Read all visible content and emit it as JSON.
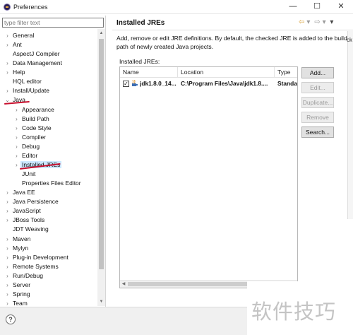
{
  "window": {
    "title": "Preferences",
    "controls": {
      "minimize": "—",
      "maximize": "☐",
      "close": "✕"
    }
  },
  "filter": {
    "placeholder": "type filter text",
    "value": ""
  },
  "tree": [
    {
      "label": "General",
      "expander": "›",
      "indent": 0
    },
    {
      "label": "Ant",
      "expander": "›",
      "indent": 0
    },
    {
      "label": "AspectJ Compiler",
      "expander": "",
      "indent": 0
    },
    {
      "label": "Data Management",
      "expander": "›",
      "indent": 0
    },
    {
      "label": "Help",
      "expander": "›",
      "indent": 0
    },
    {
      "label": "HQL editor",
      "expander": "",
      "indent": 0
    },
    {
      "label": "Install/Update",
      "expander": "›",
      "indent": 0
    },
    {
      "label": "Java",
      "expander": "⌄",
      "indent": 0
    },
    {
      "label": "Appearance",
      "expander": "›",
      "indent": 1
    },
    {
      "label": "Build Path",
      "expander": "›",
      "indent": 1
    },
    {
      "label": "Code Style",
      "expander": "›",
      "indent": 1
    },
    {
      "label": "Compiler",
      "expander": "›",
      "indent": 1
    },
    {
      "label": "Debug",
      "expander": "›",
      "indent": 1
    },
    {
      "label": "Editor",
      "expander": "›",
      "indent": 1
    },
    {
      "label": "Installed JREs",
      "expander": "›",
      "indent": 1,
      "selected": true
    },
    {
      "label": "JUnit",
      "expander": "",
      "indent": 1
    },
    {
      "label": "Properties Files Editor",
      "expander": "",
      "indent": 1
    },
    {
      "label": "Java EE",
      "expander": "›",
      "indent": 0
    },
    {
      "label": "Java Persistence",
      "expander": "›",
      "indent": 0
    },
    {
      "label": "JavaScript",
      "expander": "›",
      "indent": 0
    },
    {
      "label": "JBoss Tools",
      "expander": "›",
      "indent": 0
    },
    {
      "label": "JDT Weaving",
      "expander": "",
      "indent": 0
    },
    {
      "label": "Maven",
      "expander": "›",
      "indent": 0
    },
    {
      "label": "Mylyn",
      "expander": "›",
      "indent": 0
    },
    {
      "label": "Plug-in Development",
      "expander": "›",
      "indent": 0
    },
    {
      "label": "Remote Systems",
      "expander": "›",
      "indent": 0
    },
    {
      "label": "Run/Debug",
      "expander": "›",
      "indent": 0
    },
    {
      "label": "Server",
      "expander": "›",
      "indent": 0
    },
    {
      "label": "Spring",
      "expander": "›",
      "indent": 0
    },
    {
      "label": "Team",
      "expander": "›",
      "indent": 0
    }
  ],
  "page": {
    "title": "Installed JREs",
    "nav": {
      "back": "⇦",
      "back_menu": "▾",
      "forward": "⇨",
      "forward_menu": "▾",
      "view_menu": "▾"
    },
    "description": "Add, remove or edit JRE definitions. By default, the checked JRE is added to the build path of newly created Java projects.",
    "installed_label": "Installed JREs:",
    "table": {
      "columns": [
        "Name",
        "Location",
        "Type"
      ],
      "rows": [
        {
          "checked": "✓",
          "name": "jdk1.8.0_14...",
          "location": "C:\\Program Files\\Java\\jdk1.8....",
          "type": "Standar"
        }
      ]
    },
    "buttons": [
      {
        "label": "Add...",
        "enabled": true
      },
      {
        "label": "Edit...",
        "enabled": false
      },
      {
        "label": "Duplicate...",
        "enabled": false
      },
      {
        "label": "Remove",
        "enabled": false
      },
      {
        "label": "Search...",
        "enabled": true
      }
    ]
  },
  "bottom": {
    "help": "?"
  },
  "edge_text": "ck",
  "watermark": "软件技巧",
  "colors": {
    "annotation_red": "#c8102e",
    "selection": "#cce8ff"
  }
}
